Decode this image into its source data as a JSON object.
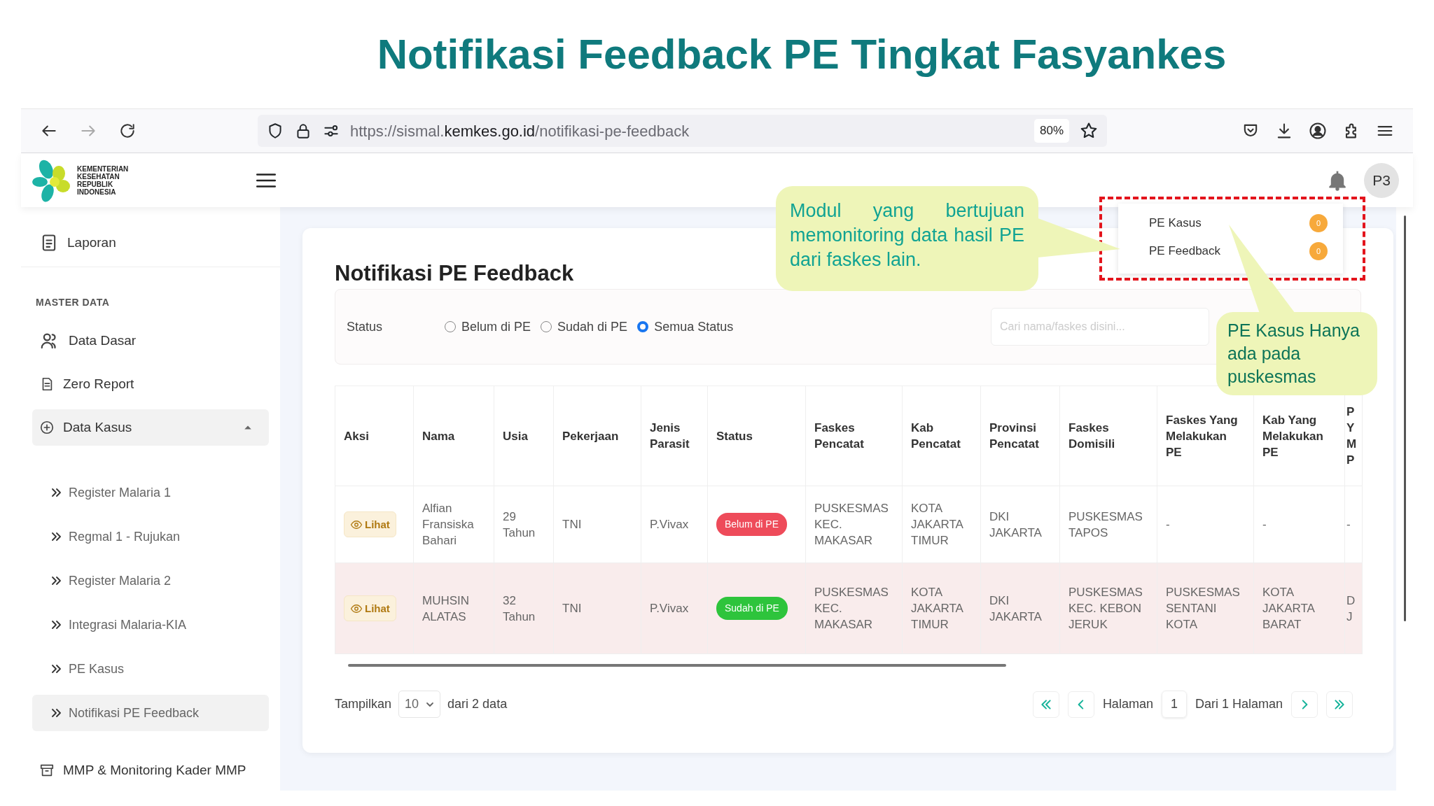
{
  "slide_title": "Notifikasi Feedback PE Tingkat Fasyankes",
  "browser": {
    "url_prefix": "https://sismal.",
    "url_domain": "kemkes.go.id",
    "url_path": "/notifikasi-pe-feedback",
    "zoom": "80%",
    "forward_disabled": true
  },
  "header": {
    "logo_lines": [
      "KEMENTERIAN",
      "KESEHATAN",
      "REPUBLIK",
      "INDONESIA"
    ],
    "avatar": "P3"
  },
  "notification_menu": [
    {
      "label": "PE Kasus",
      "count": "0"
    },
    {
      "label": "PE Feedback",
      "count": "0"
    }
  ],
  "sidebar": {
    "items": [
      {
        "kind": "link",
        "label": "Laporan",
        "selected": false
      },
      {
        "kind": "heading",
        "label": "MASTER DATA"
      },
      {
        "kind": "link",
        "label": "Data Dasar",
        "selected": false
      },
      {
        "kind": "link",
        "label": "Zero Report",
        "selected": false
      },
      {
        "kind": "group",
        "label": "Data Kasus",
        "expanded": true,
        "children": [
          {
            "label": "Register Malaria 1",
            "selected": false
          },
          {
            "label": "Regmal 1 - Rujukan",
            "selected": false
          },
          {
            "label": "Register Malaria 2",
            "selected": false
          },
          {
            "label": "Integrasi Malaria-KIA",
            "selected": false
          },
          {
            "label": "PE Kasus",
            "selected": false
          },
          {
            "label": "Notifikasi PE Feedback",
            "selected": true
          }
        ]
      },
      {
        "kind": "link",
        "label": "MMP & Monitoring Kader MMP",
        "selected": false
      }
    ]
  },
  "card_title": "Notifikasi PE Feedback",
  "filter": {
    "label": "Status",
    "options": [
      {
        "label": "Belum di PE",
        "selected": false
      },
      {
        "label": "Sudah di PE",
        "selected": false
      },
      {
        "label": "Semua Status",
        "selected": true
      }
    ],
    "search_placeholder": "Cari nama/faskes disini..."
  },
  "table": {
    "columns": [
      "Aksi",
      "Nama",
      "Usia",
      "Pekerjaan",
      "Jenis Parasit",
      "Status",
      "Faskes Pencatat",
      "Kab Pencatat",
      "Provinsi Pencatat",
      "Faskes Domisili",
      "Faskes Yang Melakukan PE",
      "Kab Yang Melakukan PE",
      "P\nY\nM\nP"
    ],
    "rows": [
      {
        "highlighted": false,
        "cells": [
          {
            "kind": "button",
            "text": "Lihat"
          },
          {
            "kind": "text",
            "text": "Alfian Fransiska Bahari"
          },
          {
            "kind": "text",
            "text": "29 Tahun"
          },
          {
            "kind": "text",
            "text": "TNI"
          },
          {
            "kind": "text",
            "text": "P.Vivax"
          },
          {
            "kind": "badge",
            "text": "Belum di PE",
            "color": "#ee4b5a"
          },
          {
            "kind": "text",
            "text": "PUSKESMAS KEC. MAKASAR"
          },
          {
            "kind": "text",
            "text": "KOTA JAKARTA TIMUR"
          },
          {
            "kind": "text",
            "text": "DKI JAKARTA"
          },
          {
            "kind": "text",
            "text": "PUSKESMAS TAPOS"
          },
          {
            "kind": "text",
            "text": "-"
          },
          {
            "kind": "text",
            "text": "-"
          },
          {
            "kind": "text",
            "text": "-"
          }
        ]
      },
      {
        "highlighted": true,
        "cells": [
          {
            "kind": "button",
            "text": "Lihat"
          },
          {
            "kind": "text",
            "text": "MUHSIN ALATAS"
          },
          {
            "kind": "text",
            "text": "32 Tahun"
          },
          {
            "kind": "text",
            "text": "TNI"
          },
          {
            "kind": "text",
            "text": "P.Vivax"
          },
          {
            "kind": "badge",
            "text": "Sudah di PE",
            "color": "#2ec43c"
          },
          {
            "kind": "text",
            "text": "PUSKESMAS KEC. MAKASAR"
          },
          {
            "kind": "text",
            "text": "KOTA JAKARTA TIMUR"
          },
          {
            "kind": "text",
            "text": "DKI JAKARTA"
          },
          {
            "kind": "text",
            "text": "PUSKESMAS KEC. KEBON JERUK"
          },
          {
            "kind": "text",
            "text": "PUSKESMAS SENTANI KOTA"
          },
          {
            "kind": "text",
            "text": "KOTA JAKARTA BARAT"
          },
          {
            "kind": "text",
            "text": "D\nJ"
          }
        ]
      }
    ]
  },
  "pagination": {
    "show_label": "Tampilkan",
    "page_size": "10",
    "total": "dari 2 data",
    "page_label": "Halaman",
    "page": "1",
    "of_pages": "Dari 1 Halaman"
  },
  "callouts": [
    {
      "text": "Modul yang bertujuan memonitoring data hasil PE dari faskes lain."
    },
    {
      "text": "PE Kasus Hanya ada pada puskesmas"
    }
  ]
}
